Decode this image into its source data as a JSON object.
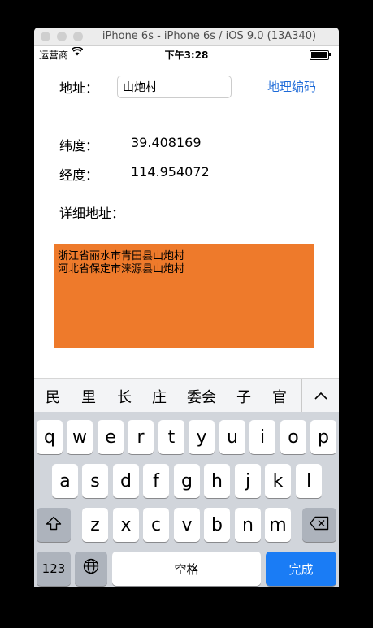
{
  "window": {
    "title": "iPhone 6s - iPhone 6s / iOS 9.0 (13A340)"
  },
  "status_bar": {
    "carrier": "运营商",
    "time": "下午3:28"
  },
  "form": {
    "address_label": "地址：",
    "address_value": "山炮村",
    "geocode_button": "地理编码",
    "latitude_label": "纬度：",
    "latitude_value": "39.408169",
    "longitude_label": "经度：",
    "longitude_value": "114.954072",
    "detail_label": "详细地址："
  },
  "results": [
    "浙江省丽水市青田县山炮村",
    "河北省保定市涞源县山炮村"
  ],
  "suggestions": [
    "民",
    "里",
    "长",
    "庄",
    "委会",
    "子",
    "官"
  ],
  "keyboard": {
    "row1": [
      "q",
      "w",
      "e",
      "r",
      "t",
      "y",
      "u",
      "i",
      "o",
      "p"
    ],
    "row2": [
      "a",
      "s",
      "d",
      "f",
      "g",
      "h",
      "j",
      "k",
      "l"
    ],
    "row3": [
      "z",
      "x",
      "c",
      "v",
      "b",
      "n",
      "m"
    ],
    "numbers_key": "123",
    "space_key": "空格",
    "done_key": "完成"
  },
  "colors": {
    "result_background": "#ee7a2b",
    "link_blue": "#1d6ad8",
    "done_key_blue": "#1a7cf5"
  },
  "icons": {
    "wifi": "wifi-icon",
    "battery": "battery-icon",
    "shift": "shift-icon",
    "backspace": "backspace-icon",
    "globe": "globe-icon",
    "collapse": "chevron-up-icon"
  }
}
